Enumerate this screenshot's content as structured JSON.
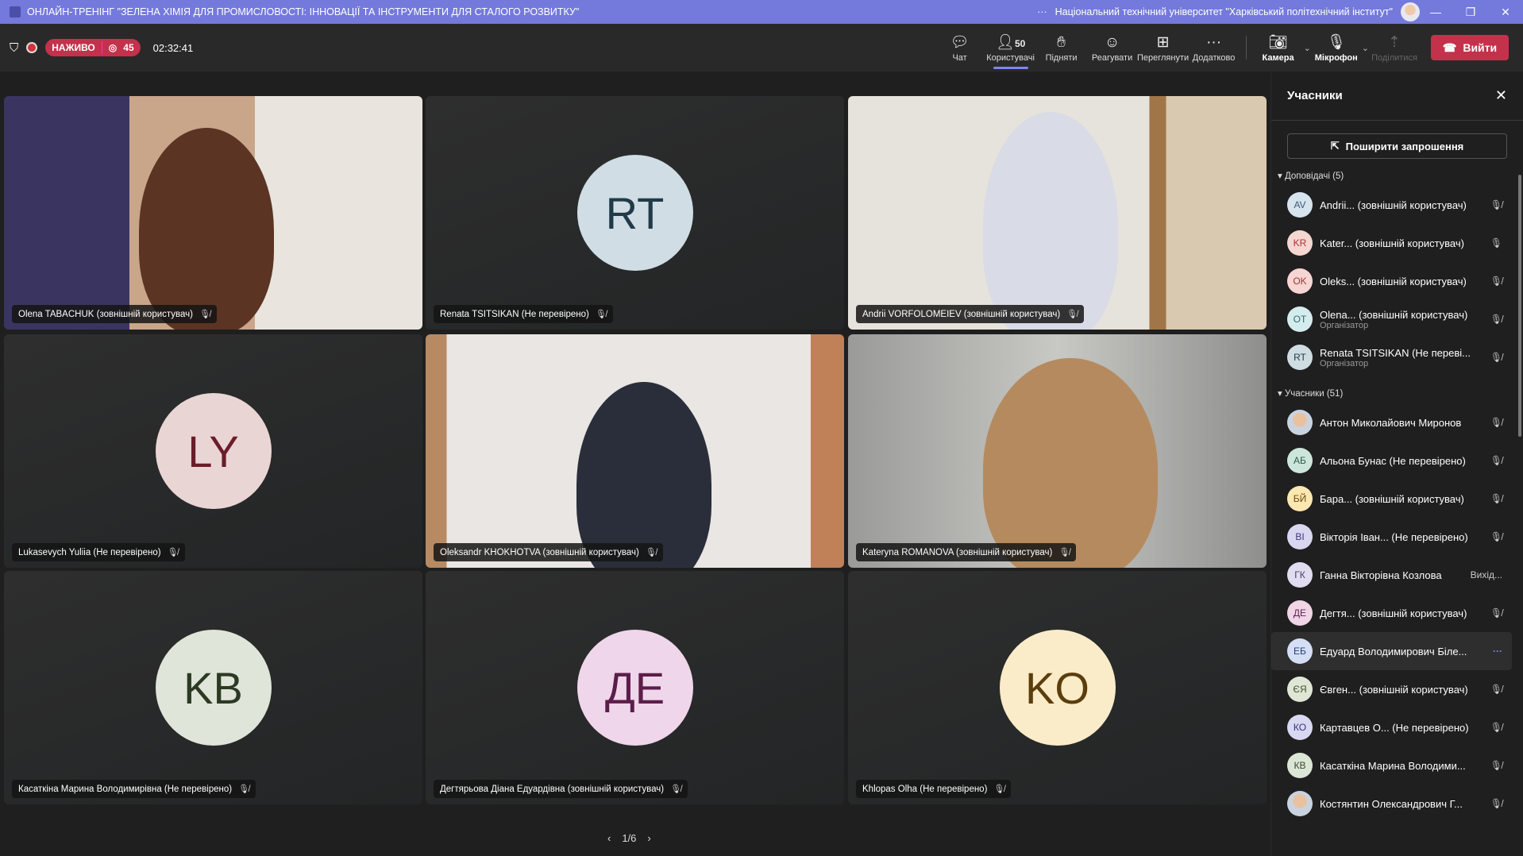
{
  "titlebar": {
    "title": "ОНЛАЙН-ТРЕНІНГ \"ЗЕЛЕНА ХІМІЯ ДЛЯ ПРОМИСЛОВОСТІ: ІННОВАЦІЇ ТА ІНСТРУМЕНТИ ДЛЯ СТАЛОГО РОЗВИТКУ\"",
    "more": "···",
    "org": "Національний технічний університет \"Харківський політехнічний інститут\""
  },
  "status": {
    "live": "НАЖИВО",
    "viewers": "45",
    "timer": "02:32:41"
  },
  "toolbar": {
    "chat": "Чат",
    "people": "Користувачі",
    "people_count": "50",
    "raise": "Підняти",
    "react": "Реагувати",
    "view": "Переглянути",
    "more": "Додатково",
    "camera": "Камера",
    "mic": "Мікрофон",
    "share": "Поділитися",
    "leave": "Вийти"
  },
  "tiles": [
    {
      "name": "Olena TABACHUK (зовнішній користувач)",
      "video": true
    },
    {
      "name": "Renata TSITSIKAN (Не перевірено)",
      "initials": "RT",
      "bg": "#d0dde4",
      "fg": "#213a48"
    },
    {
      "name": "Andrii VORFOLOMEIEV (зовнішній користувач)",
      "video": true
    },
    {
      "name": "Lukasevych Yuliia (Не перевірено)",
      "initials": "LY",
      "bg": "#ead5d5",
      "fg": "#6b1d2a"
    },
    {
      "name": "Oleksandr KHOKHOTVA (зовнішній користувач)",
      "video": true
    },
    {
      "name": "Kateryna ROMANOVA (зовнішній користувач)",
      "video": true
    },
    {
      "name": "Касаткіна Марина Володимирівна (Не перевірено)",
      "initials": "KB",
      "bg": "#dfe5d9",
      "fg": "#2c3a24"
    },
    {
      "name": "Дегтярьова Діана Едуардівна (зовнішній користувач)",
      "initials": "ДЕ",
      "bg": "#efd6ea",
      "fg": "#5c1d4a"
    },
    {
      "name": "Khlopas Olha (Не перевірено)",
      "initials": "KO",
      "bg": "#fbecc9",
      "fg": "#5c3d0c"
    }
  ],
  "pager": {
    "page": "1/6"
  },
  "panel": {
    "title": "Учасники",
    "share": "Поширити запрошення",
    "presenters_label": "Доповідачі (5)",
    "presenters": [
      {
        "initials": "AV",
        "bg": "#d6e4ee",
        "fg": "#3b5a76",
        "name": "Andrii... (зовнішній користувач)",
        "status": "mic-off"
      },
      {
        "initials": "KR",
        "bg": "#f5d6d0",
        "fg": "#a33",
        "name": "Kater...  (зовнішній користувач)",
        "status": "mic-on"
      },
      {
        "initials": "OK",
        "bg": "#f7d5d3",
        "fg": "#a33",
        "name": "Oleks... (зовнішній користувач)",
        "status": "mic-off"
      },
      {
        "initials": "OT",
        "bg": "#d5ecee",
        "fg": "#2f6b70",
        "name": "Olena... (зовнішній користувач)",
        "sub": "Організатор",
        "status": "mic-off"
      },
      {
        "initials": "RT",
        "bg": "#cfdde3",
        "fg": "#213a48",
        "name": "Renata TSITSIKAN (Не переві...",
        "sub": "Організатор",
        "status": "mic-off"
      }
    ],
    "attendees_label": "Учасники (51)",
    "attendees": [
      {
        "initials": "",
        "photo": true,
        "name": "Антон Миколайович Миронов",
        "status": "mic-off"
      },
      {
        "initials": "АБ",
        "bg": "#cde6dc",
        "fg": "#2c5a46",
        "name": "Альона Бунас (Не перевірено)",
        "status": "mic-off"
      },
      {
        "initials": "БЙ",
        "bg": "#fbe7b0",
        "fg": "#6b4b0c",
        "name": "Бара...  (зовнішній користувач)",
        "status": "mic-off"
      },
      {
        "initials": "ВІ",
        "bg": "#d9d6f0",
        "fg": "#3c3780",
        "name": "Вікторія Іван... (Не перевірено)",
        "status": "mic-off"
      },
      {
        "initials": "ГК",
        "bg": "#e1dcef",
        "fg": "#4a3f6b",
        "name": "Ганна Вікторівна Козлова",
        "status_text": "Вихід..."
      },
      {
        "initials": "ДЕ",
        "bg": "#efd5e6",
        "fg": "#6b1d55",
        "name": "Дегтя... (зовнішній користувач)",
        "status": "mic-off"
      },
      {
        "initials": "ЕБ",
        "bg": "#d4def5",
        "fg": "#2b3f75",
        "name": "Едуард Володимирович Біле...",
        "status": "more",
        "highlight": true
      },
      {
        "initials": "ЄЯ",
        "bg": "#dfe6d6",
        "fg": "#44502f",
        "name": "Євген... (зовнішній користувач)",
        "status": "mic-off"
      },
      {
        "initials": "КО",
        "bg": "#d8d8f2",
        "fg": "#33337a",
        "name": "Картавцев О... (Не перевірено)",
        "status": "mic-off"
      },
      {
        "initials": "КВ",
        "bg": "#dce6d6",
        "fg": "#3a4a2c",
        "name": "Касаткіна Марина Володими...",
        "status": "mic-off"
      },
      {
        "initials": "",
        "photo": true,
        "name": "Костянтин Олександрович Г...",
        "status": "mic-off"
      }
    ]
  }
}
